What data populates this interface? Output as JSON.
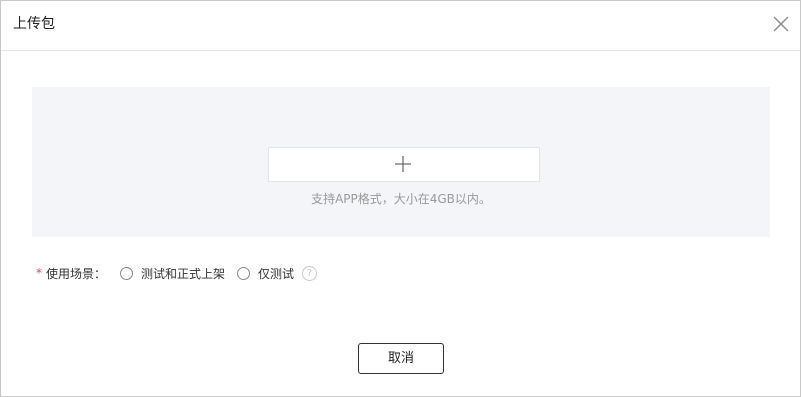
{
  "dialog": {
    "title": "上传包",
    "close_icon": "close-icon"
  },
  "upload": {
    "add_icon": "plus-icon",
    "hint": "支持APP格式，大小在4GB以内。"
  },
  "scene": {
    "required_mark": "*",
    "label": "使用场景：",
    "options": [
      {
        "label": "测试和正式上架",
        "selected": false
      },
      {
        "label": "仅测试",
        "selected": false
      }
    ],
    "help_icon": "question-circle-icon",
    "help_glyph": "?"
  },
  "footer": {
    "cancel_label": "取消"
  },
  "colors": {
    "upload_area_bg": "#f4f5f8",
    "required": "#e64545",
    "hint_text": "#999999"
  }
}
